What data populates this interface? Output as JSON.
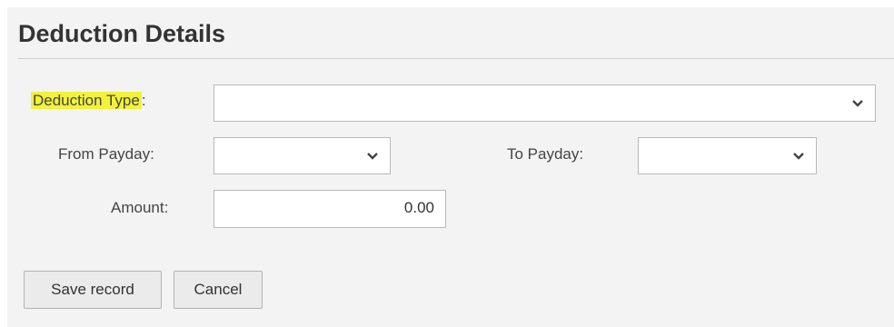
{
  "form": {
    "title": "Deduction Details",
    "deduction_type": {
      "label": "Deduction Type",
      "label_suffix": ":",
      "value": "",
      "icon": "chevron-down-icon",
      "highlight_color": "#f2f23a"
    },
    "from_payday": {
      "label": "From Payday:",
      "value": "",
      "icon": "chevron-down-icon"
    },
    "to_payday": {
      "label": "To Payday:",
      "value": "",
      "icon": "chevron-down-icon"
    },
    "amount": {
      "label": "Amount:",
      "value": "0.00"
    }
  },
  "actions": {
    "save_label": "Save record",
    "cancel_label": "Cancel"
  }
}
